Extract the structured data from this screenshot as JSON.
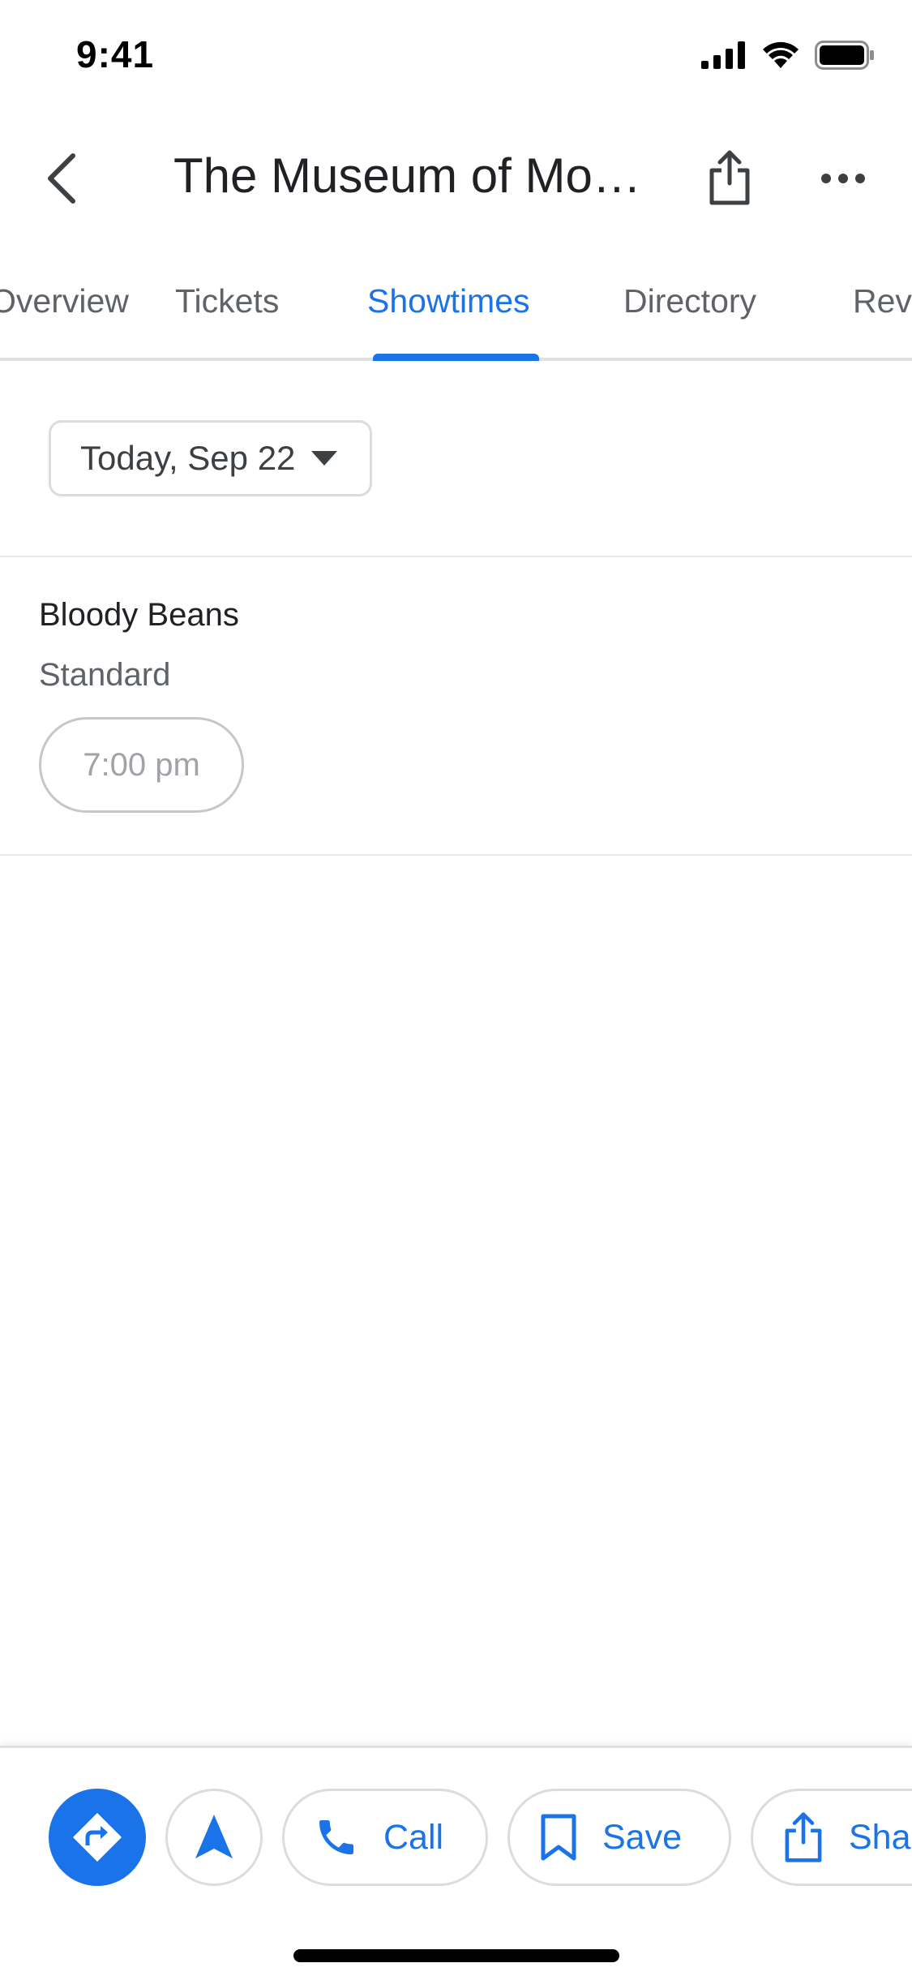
{
  "status_bar": {
    "time": "9:41"
  },
  "header": {
    "title": "The Museum of Mod..."
  },
  "tabs": [
    {
      "label": "Overview"
    },
    {
      "label": "Tickets"
    },
    {
      "label": "Showtimes"
    },
    {
      "label": "Directory"
    },
    {
      "label": "Reviews"
    }
  ],
  "active_tab": "Showtimes",
  "date_selector": {
    "label": "Today, Sep 22"
  },
  "movies": [
    {
      "title": "Bloody Beans",
      "format": "Standard",
      "showtimes": [
        "7:00 pm"
      ]
    }
  ],
  "actions": {
    "call_label": "Call",
    "save_label": "Save",
    "share_label": "Share"
  },
  "colors": {
    "accent": "#1a73e8",
    "text_primary": "#202124",
    "text_secondary": "#5f6368",
    "border": "#dadce0"
  },
  "icons": [
    "back-arrow-icon",
    "share-icon",
    "more-icon",
    "dropdown-icon",
    "directions-icon",
    "navigation-arrow-icon",
    "phone-icon",
    "bookmark-icon"
  ]
}
